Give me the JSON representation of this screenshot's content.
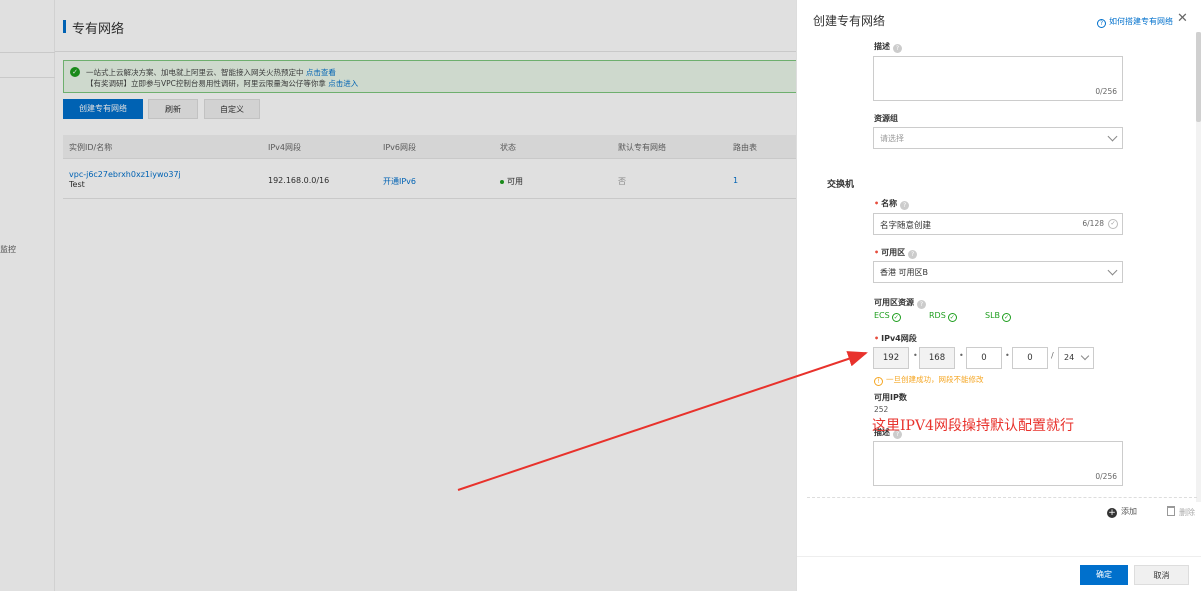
{
  "page": {
    "title": "专有网络",
    "side_label": "监控",
    "notice": {
      "line1": "一站式上云解决方案、加电就上阿里云、智能接入网关火热预定中",
      "line1_link": "点击查看",
      "line2": "【有奖调研】立即参与VPC控制台易用性调研，阿里云限量淘公仔等你拿",
      "line2_link": "点击进入"
    },
    "toolbar": {
      "create": "创建专有网络",
      "refresh": "刷新",
      "customize": "自定义"
    },
    "table": {
      "headers": [
        "实例ID/名称",
        "IPv4网段",
        "IPv6网段",
        "状态",
        "默认专有网络",
        "路由表"
      ],
      "row": {
        "id": "vpc-j6c27ebrxh0xz1iywo37j",
        "name": "Test",
        "ipv4": "192.168.0.0/16",
        "ipv6": "开通IPv6",
        "status": "可用",
        "default": "否",
        "route": "1"
      }
    }
  },
  "drawer": {
    "title": "创建专有网络",
    "help": "如何搭建专有网络",
    "vpc_desc": {
      "label": "描述",
      "counter": "0/256"
    },
    "resource_group": {
      "label": "资源组",
      "placeholder": "请选择"
    },
    "switch_section": "交换机",
    "name": {
      "label": "名称",
      "value": "名字随意创建",
      "counter": "6/128"
    },
    "zone": {
      "label": "可用区",
      "value": "香港 可用区B"
    },
    "zone_resources": {
      "label": "可用区资源",
      "items": [
        "ECS",
        "RDS",
        "SLB"
      ]
    },
    "ipv4": {
      "label": "IPv4网段",
      "octets": [
        "192",
        "168",
        "0",
        "0"
      ],
      "mask": "24",
      "warning": "一旦创建成功，网段不能修改"
    },
    "available_ips": {
      "label": "可用IP数",
      "value": "252"
    },
    "switch_desc": {
      "label": "描述",
      "counter": "0/256"
    },
    "add": "添加",
    "delete": "删除",
    "ok": "确定",
    "cancel": "取消"
  },
  "annotation": "这里IPV4网段操持默认配置就行",
  "colors": {
    "primary": "#0070cc",
    "annotation": "#e8322c",
    "success": "#1e9e1e",
    "warning": "#f5a623"
  }
}
